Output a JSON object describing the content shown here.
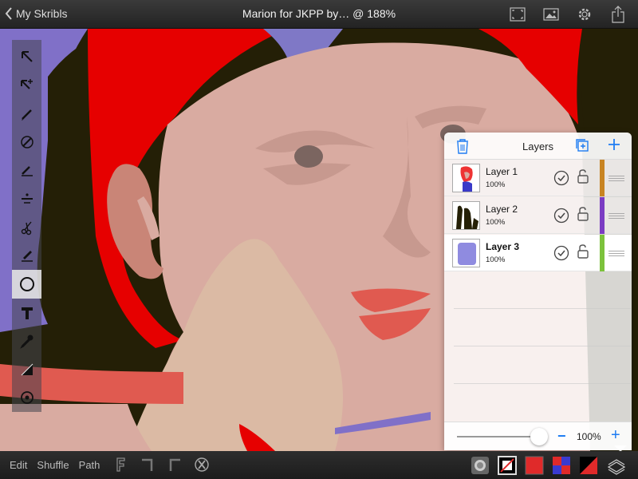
{
  "header": {
    "back_label": "My Skribls",
    "title": "Marion for JKPP by… @ 188%",
    "icons": [
      "fit-screen-icon",
      "image-icon",
      "gear-icon",
      "share-icon"
    ]
  },
  "toolbar": {
    "tools": [
      "select-arrow-icon",
      "add-point-icon",
      "pen-icon",
      "pen-nib-icon",
      "brush-icon",
      "divide-icon",
      "scissors-icon",
      "marker-icon",
      "ellipse-icon",
      "text-icon",
      "eyedropper-icon",
      "gradient-icon",
      "target-icon"
    ],
    "active_tool": "ellipse-icon"
  },
  "layers": {
    "title": "Layers",
    "items": [
      {
        "name": "Layer 1",
        "opacity": "100%",
        "color": "#c88422",
        "selected": false
      },
      {
        "name": "Layer 2",
        "opacity": "100%",
        "color": "#7b3cc3",
        "selected": false
      },
      {
        "name": "Layer 3",
        "opacity": "100%",
        "color": "#7cc23c",
        "selected": true
      }
    ],
    "opacity_value": "100%",
    "opacity_level": 1.0
  },
  "footer": {
    "edit_label": "Edit",
    "shuffle_label": "Shuffle",
    "path_label": "Path",
    "fill_color": "#e02a2a",
    "accent_colors": [
      "#e02a2a",
      "#3a3ad0",
      "#000000"
    ]
  },
  "colors": {
    "accent": "#1e7cf2",
    "canvas_red": "#e60000",
    "skin": "#d9aba1",
    "lavender": "#8070c8",
    "dark_bg": "#241f06"
  }
}
